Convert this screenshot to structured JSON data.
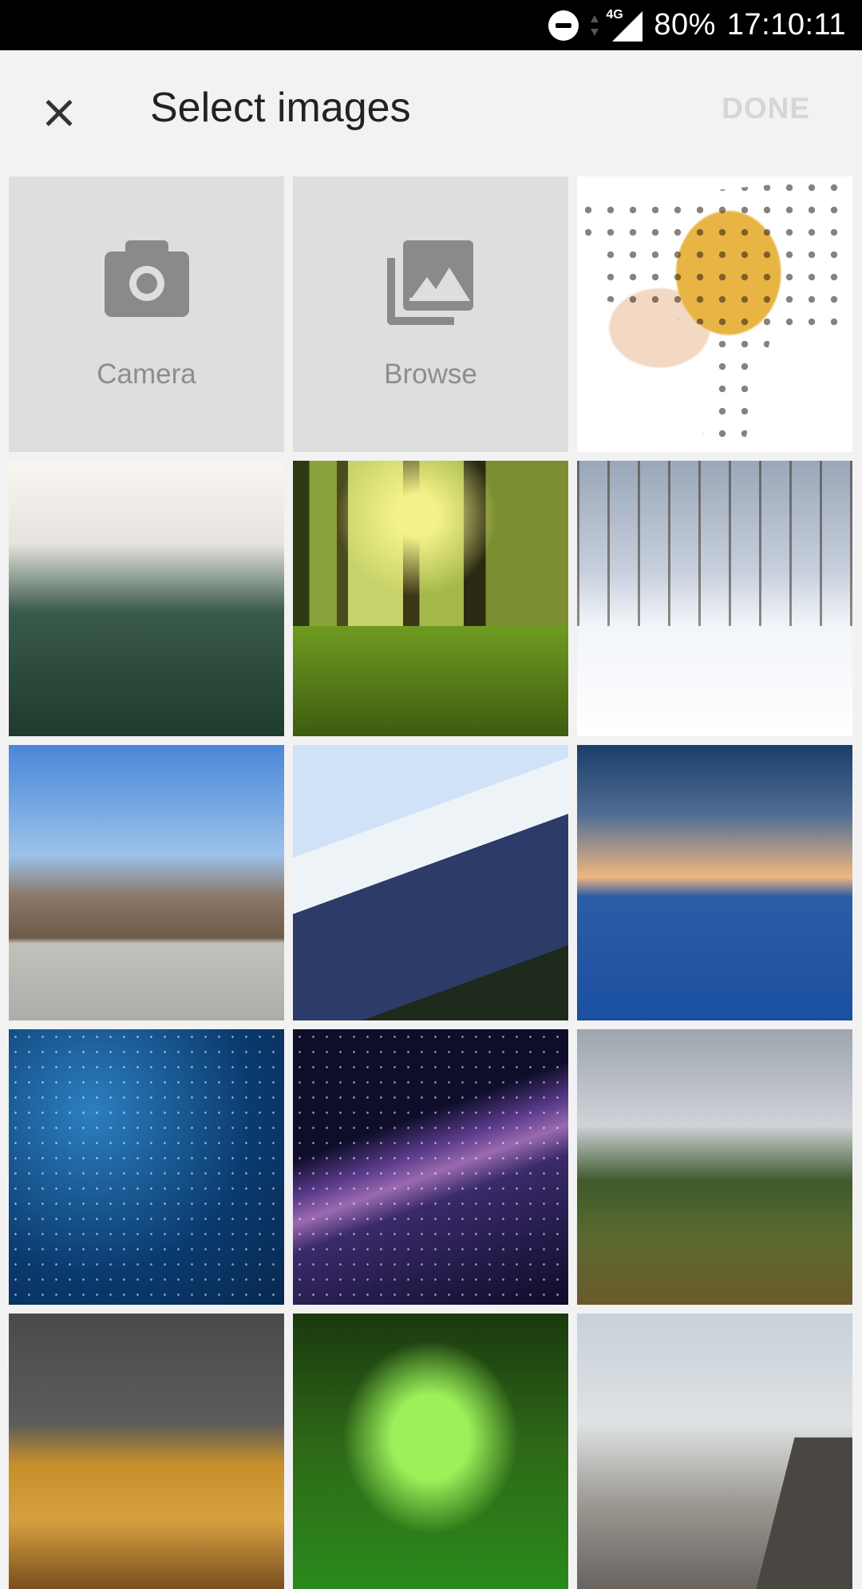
{
  "status_bar": {
    "network": "4G",
    "battery": "80%",
    "time": "17:10:11",
    "icons": [
      "do-not-disturb-icon",
      "data-arrows-icon",
      "signal-icon"
    ]
  },
  "app_bar": {
    "close_icon": "close-icon",
    "title": "Select images",
    "done_label": "DONE",
    "done_color": "#d6d6d6"
  },
  "actions": [
    {
      "label": "Camera",
      "icon": "camera-icon"
    },
    {
      "label": "Browse",
      "icon": "gallery-icon"
    }
  ],
  "photos": [
    {
      "name": "photo-leopard-gecko"
    },
    {
      "name": "photo-foggy-forest"
    },
    {
      "name": "photo-sunlit-forest"
    },
    {
      "name": "photo-snowy-trees"
    },
    {
      "name": "photo-mountain-valley"
    },
    {
      "name": "photo-snowy-peaks"
    },
    {
      "name": "photo-ocean-sunset"
    },
    {
      "name": "photo-blue-starfield"
    },
    {
      "name": "photo-milky-way"
    },
    {
      "name": "photo-meadow-trees"
    },
    {
      "name": "photo-autumn-rainbow"
    },
    {
      "name": "photo-green-jungle"
    },
    {
      "name": "photo-hiker-cliff"
    }
  ]
}
